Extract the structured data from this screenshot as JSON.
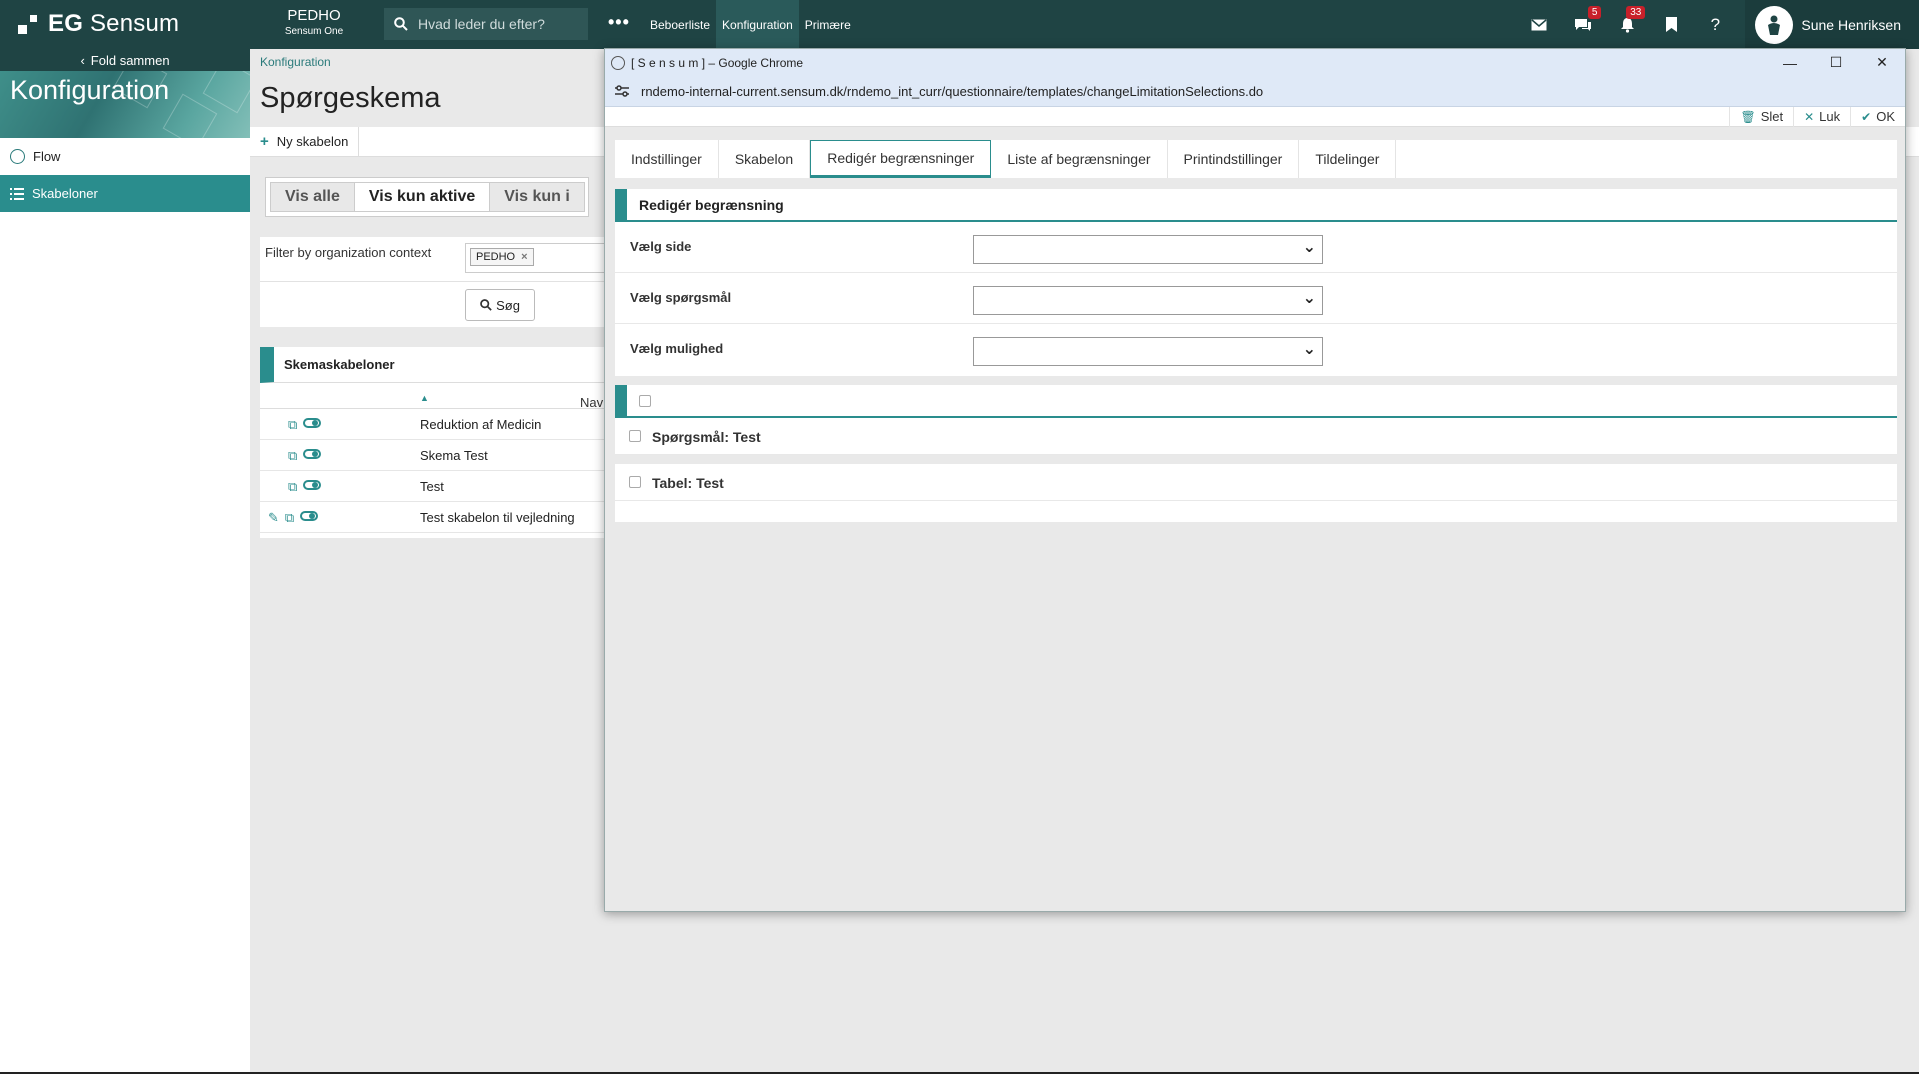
{
  "topbar": {
    "logo_prefix": "EG",
    "logo_name": "Sensum",
    "org_name": "PEDHO",
    "org_sub": "Sensum One",
    "search_placeholder": "Hvad leder du efter?",
    "more_label": "•••",
    "nav": [
      "Beboerliste",
      "Konfiguration",
      "Primære"
    ],
    "active_nav": "Konfiguration",
    "messages_badge": "5",
    "notifications_badge": "33",
    "help_label": "?",
    "user_name": "Sune Henriksen"
  },
  "sidebar": {
    "fold_label": "Fold sammen",
    "section_title": "Konfiguration",
    "items": [
      {
        "label": "Flow",
        "active": false
      },
      {
        "label": "Skabeloner",
        "active": true
      }
    ]
  },
  "main": {
    "breadcrumb": "Konfiguration",
    "title": "Spørgeskema",
    "new_template_label": "Ny skabelon",
    "segments": [
      "Vis alle",
      "Vis kun aktive",
      "Vis kun i"
    ],
    "selected_segment": "Vis kun aktive",
    "filter_label": "Filter by organization context",
    "filter_chip": "PEDHO",
    "search_button": "Søg",
    "list_title": "Skemaskabeloner",
    "column_name": "Navn",
    "rows": [
      {
        "name": "Reduktion af Medicin",
        "editable": false
      },
      {
        "name": "Skema Test",
        "editable": false
      },
      {
        "name": "Test",
        "editable": false
      },
      {
        "name": "Test skabelon til vejledning",
        "editable": true
      }
    ]
  },
  "popup": {
    "window_title": "[ S e n s u m ] – Google Chrome",
    "url": "rndemo-internal-current.sensum.dk/rndemo_int_curr/questionnaire/templates/changeLimitationSelections.do",
    "actions": {
      "delete": "Slet",
      "close": "Luk",
      "ok": "OK"
    },
    "tabs": [
      "Indstillinger",
      "Skabelon",
      "Redigér begrænsninger",
      "Liste af begrænsninger",
      "Printindstillinger",
      "Tildelinger"
    ],
    "active_tab": "Redigér begrænsninger",
    "form_title": "Redigér begrænsning",
    "fields": [
      {
        "label": "Vælg side",
        "value": ""
      },
      {
        "label": "Vælg spørgsmål",
        "value": ""
      },
      {
        "label": "Vælg mulighed",
        "value": ""
      }
    ],
    "items": [
      {
        "label": "Spørgsmål: Test",
        "checked": false
      },
      {
        "label": "Tabel: Test",
        "checked": false
      }
    ]
  }
}
